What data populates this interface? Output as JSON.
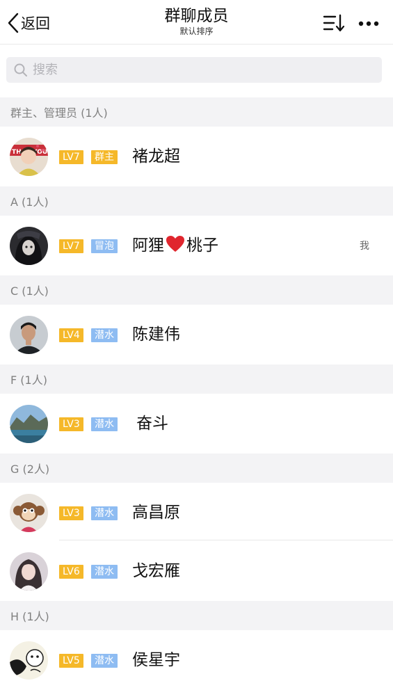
{
  "header": {
    "back_label": "返回",
    "title": "群聊成员",
    "subtitle": "默认排序"
  },
  "search": {
    "placeholder": "搜索"
  },
  "sections": [
    {
      "header": "群主、管理员 (1人)"
    },
    {
      "header": "A (1人)"
    },
    {
      "header": "C (1人)"
    },
    {
      "header": "F (1人)"
    },
    {
      "header": "G (2人)"
    },
    {
      "header": "H (1人)"
    }
  ],
  "members": [
    {
      "level": "LV7",
      "role": "群主",
      "name": "褚龙超"
    },
    {
      "level": "LV7",
      "role": "冒泡",
      "name_before": "阿狸",
      "name_after": "桃子",
      "me_label": "我"
    },
    {
      "level": "LV4",
      "role": "潜水",
      "name": "陈建伟"
    },
    {
      "level": "LV3",
      "role": "潜水",
      "name": "奋斗"
    },
    {
      "level": "LV3",
      "role": "潜水",
      "name": "高昌原"
    },
    {
      "level": "LV6",
      "role": "潜水",
      "name": "戈宏雁"
    },
    {
      "level": "LV5",
      "role": "潜水",
      "name": "侯星宇"
    }
  ],
  "colors": {
    "level_badge": "#f5b829",
    "owner_badge": "#f5b829",
    "role_badge": "#8ebcf2",
    "section_bg": "#f3f3f5",
    "heart": "#e0262e"
  },
  "icons": {
    "back": "chevron-left-icon",
    "sort": "sort-list-icon",
    "more": "more-dots-icon",
    "search": "search-icon",
    "heart": "heart-icon"
  }
}
